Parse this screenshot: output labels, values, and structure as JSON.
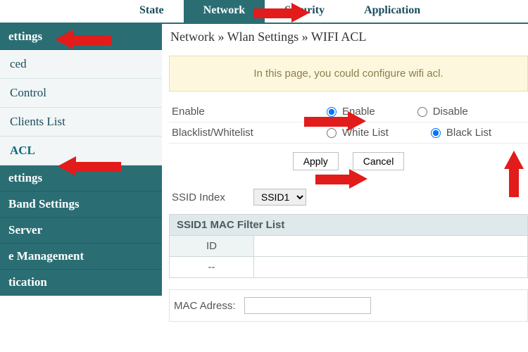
{
  "topnav": {
    "tabs": [
      "State",
      "Network",
      "Security",
      "Application"
    ],
    "active_index": 1
  },
  "breadcrumb": [
    "Network",
    "Wlan Settings",
    "WIFI ACL"
  ],
  "notice": "In this page, you could configure wifi acl.",
  "sidebar": {
    "groups": [
      {
        "title": "ettings",
        "items": [
          "ced",
          "Control",
          "Clients List",
          "ACL"
        ],
        "active_index": 3
      },
      {
        "title": "ettings",
        "items": []
      },
      {
        "title": "Band Settings",
        "items": []
      },
      {
        "title": "Server",
        "items": []
      },
      {
        "title": "e Management",
        "items": []
      },
      {
        "title": "tication",
        "items": []
      }
    ]
  },
  "form": {
    "enable": {
      "label": "Enable",
      "options": [
        "Enable",
        "Disable"
      ],
      "selected": 0
    },
    "listmode": {
      "label": "Blacklist/Whitelist",
      "options": [
        "White List",
        "Black List"
      ],
      "selected": 1
    },
    "apply": "Apply",
    "cancel": "Cancel"
  },
  "ssid": {
    "label": "SSID Index",
    "options": [
      "SSID1"
    ],
    "selected": "SSID1"
  },
  "table": {
    "title": "SSID1 MAC Filter List",
    "columns": [
      "ID"
    ],
    "rows": [
      [
        "--"
      ]
    ]
  },
  "mac": {
    "label": "MAC Adress:",
    "value": ""
  }
}
